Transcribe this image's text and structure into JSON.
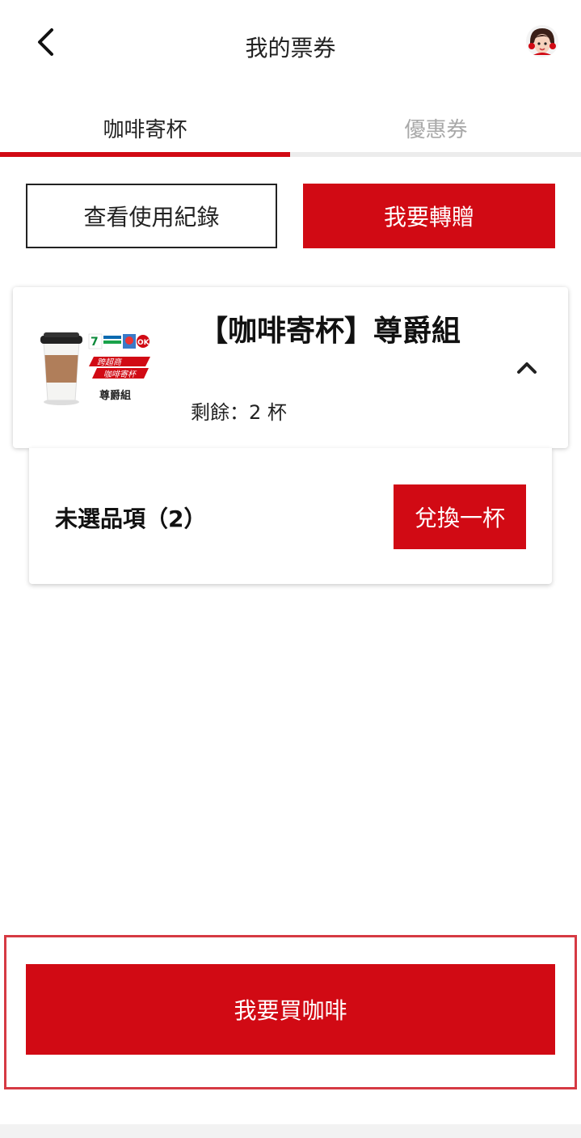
{
  "header": {
    "title": "我的票券",
    "back_icon": "chevron-left-icon",
    "avatar_icon": "user-avatar-icon"
  },
  "tabs": [
    {
      "label": "咖啡寄杯",
      "active": true
    },
    {
      "label": "優惠券",
      "active": false
    }
  ],
  "actions": {
    "history_label": "查看使用紀錄",
    "transfer_label": "我要轉贈"
  },
  "product": {
    "title": "【咖啡寄杯】尊爵組",
    "remaining": "剩餘：2 杯",
    "image": {
      "badge_line1": "跨超商",
      "badge_line2": "咖啡寄杯",
      "caption": "尊爵組"
    },
    "expanded": true
  },
  "panel": {
    "unselected_label": "未選品項（2）",
    "redeem_label": "兌換一杯"
  },
  "footer": {
    "buy_label": "我要買咖啡"
  },
  "colors": {
    "brand_red": "#d10a14",
    "highlight_border": "#d63a43"
  }
}
